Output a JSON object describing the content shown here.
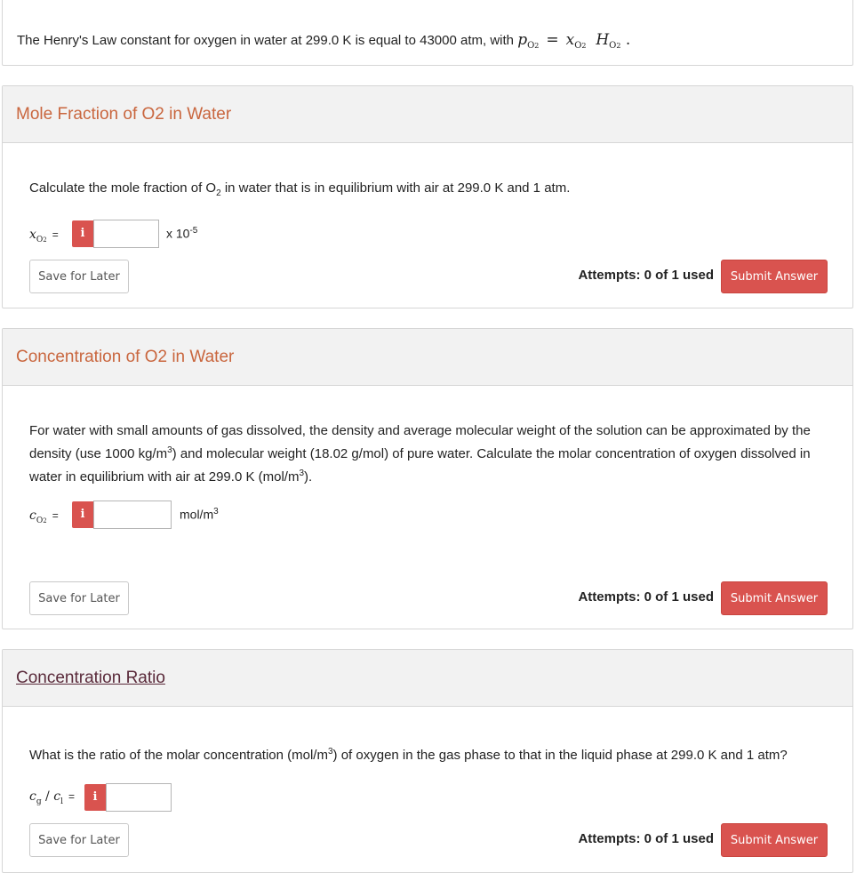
{
  "intro": {
    "text": "The Henry's Law constant for oxygen in water at 299.0 K is equal to 43000 atm, with",
    "eq_lhs": "p",
    "eq_rhs_x": "x",
    "eq_rhs_h": "H",
    "sub_o2": "O",
    "sub_2": "2"
  },
  "parts": [
    {
      "title": "Mole Fraction of O2 in Water",
      "question_a": "Calculate the mole fraction of O",
      "question_b": " in water that is in equilibrium with air at 299.0 K and 1 atm.",
      "var_symbol": "x",
      "var_sub": "O",
      "equals": "=",
      "info": "i",
      "unit_prefix": "x 10",
      "unit_exp": "-5",
      "input_value": "",
      "save_label": "Save for Later",
      "attempts": "Attempts: 0 of 1 used",
      "submit_label": "Submit Answer"
    },
    {
      "title": "Concentration of O2 in Water",
      "question_a": "For water with small amounts of gas dissolved, the density and average molecular weight of the solution can be approximated by the density (use 1000 kg/m",
      "question_b": ") and molecular weight (18.02 g/mol) of pure water.  Calculate the molar concentration of oxygen dissolved in water in equilibrium with air at 299.0 K (mol/m",
      "question_c": ").",
      "var_symbol": "c",
      "var_sub": "O",
      "equals": "=",
      "info": "i",
      "unit_prefix": "mol/m",
      "unit_exp": "3",
      "input_value": "",
      "save_label": "Save for Later",
      "attempts": "Attempts: 0 of 1 used",
      "submit_label": "Submit Answer"
    },
    {
      "title": "Concentration Ratio",
      "question_a": "What is the ratio of the molar concentration (mol/m",
      "question_b": ") of oxygen in the gas phase to that in the liquid phase at 299.0 K and 1 atm?",
      "var_num": "c",
      "var_num_sub": "g",
      "var_slash": " / ",
      "var_den": "c",
      "var_den_sub": "l",
      "equals": "=",
      "info": "i",
      "input_value": "",
      "save_label": "Save for Later",
      "attempts": "Attempts: 0 of 1 used",
      "submit_label": "Submit Answer"
    }
  ],
  "colors": {
    "accent": "#d9534f",
    "title": "#c9663e",
    "header_bg": "#f2f2f2"
  }
}
